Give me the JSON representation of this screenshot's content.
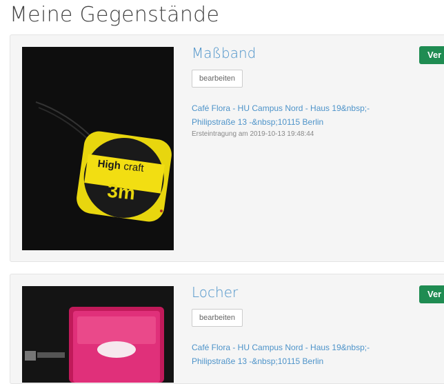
{
  "page": {
    "title": "Meine Gegenstände"
  },
  "colors": {
    "link": "#4d93c9",
    "badge": "#1f8c52",
    "card_bg": "#f5f5f5"
  },
  "items": [
    {
      "title": "Maßband",
      "edit_label": "bearbeiten",
      "location_line1": "Café Flora - HU Campus Nord - Haus 19&nbsp;-",
      "location_line2": "Philipstraße 13 -&nbsp;10115 Berlin",
      "first_entry": "Ersteintragung am 2019-10-13 19:48:44",
      "status": "Ver",
      "image_text_brand_a": "High",
      "image_text_brand_b": "craft",
      "image_text_size": "3m"
    },
    {
      "title": "Locher",
      "edit_label": "bearbeiten",
      "location_line1": "Café Flora - HU Campus Nord - Haus 19&nbsp;-",
      "location_line2": "Philipstraße 13 -&nbsp;10115 Berlin",
      "status": "Ver"
    }
  ]
}
